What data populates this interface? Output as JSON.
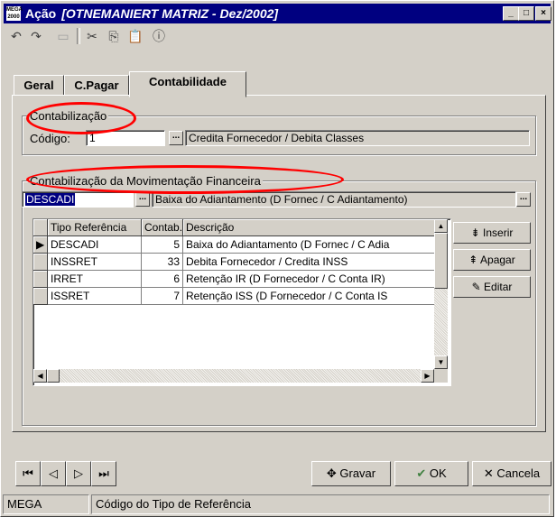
{
  "window": {
    "app_icon_text": "MEGA 2000",
    "title": "Ação",
    "title_sub": "[OTNEMANIERT MATRIZ - Dez/2002]",
    "minimize_label": "_",
    "maximize_label": "□",
    "close_label": "×"
  },
  "toolbar": {
    "undo_icon": "↶",
    "redo_icon": "↷",
    "minus_icon": "▭",
    "cut_icon": "✂",
    "copy_icon": "⎘",
    "paste_icon": "📋",
    "info_icon": "ⓘ"
  },
  "tabs": [
    {
      "label": "Geral",
      "active": false
    },
    {
      "label": "C.Pagar",
      "active": false
    },
    {
      "label": "Contabilidade",
      "active": true
    }
  ],
  "contabilizacao": {
    "legend": "Contabilização",
    "codigo_label": "Código:",
    "codigo_value": "1",
    "ellipsis": "...",
    "description": "Credita Fornecedor / Debita Classes"
  },
  "movimentacao": {
    "legend": "Contabilização da Movimentação Financeira",
    "code_value": "DESCADI",
    "ellipsis": "...",
    "description": "Baixa do Adiantamento (D Fornec / C Adiantamento)",
    "right_ellipsis": "..."
  },
  "grid": {
    "headers": [
      "Tipo Referência",
      "Contab.",
      "Descrição"
    ],
    "rows": [
      {
        "tipo": "DESCADI",
        "contab": "5",
        "descricao": "Baixa do Adiantamento (D Fornec / C Adia",
        "selected": true
      },
      {
        "tipo": "INSSRET",
        "contab": "33",
        "descricao": "Debita Fornecedor / Credita INSS",
        "selected": false
      },
      {
        "tipo": "IRRET",
        "contab": "6",
        "descricao": "Retenção IR (D Fornecedor / C Conta IR)",
        "selected": false
      },
      {
        "tipo": "ISSRET",
        "contab": "7",
        "descricao": "Retenção ISS (D Fornecedor / C Conta IS",
        "selected": false
      }
    ],
    "selected_marker": "▶"
  },
  "side_buttons": {
    "inserir": "Inserir",
    "apagar": "Apagar",
    "editar": "Editar"
  },
  "nav": {
    "first": "⏮",
    "prev": "◁",
    "next": "▷",
    "last": "⏭"
  },
  "actions": {
    "gravar": "Gravar",
    "ok": "OK",
    "cancela": "Cancela"
  },
  "status": {
    "left": "MEGA",
    "right": "Código do Tipo de Referência"
  },
  "colors": {
    "titlebar": "#000080",
    "face": "#d4d0c8",
    "annotation": "#ff0000"
  }
}
